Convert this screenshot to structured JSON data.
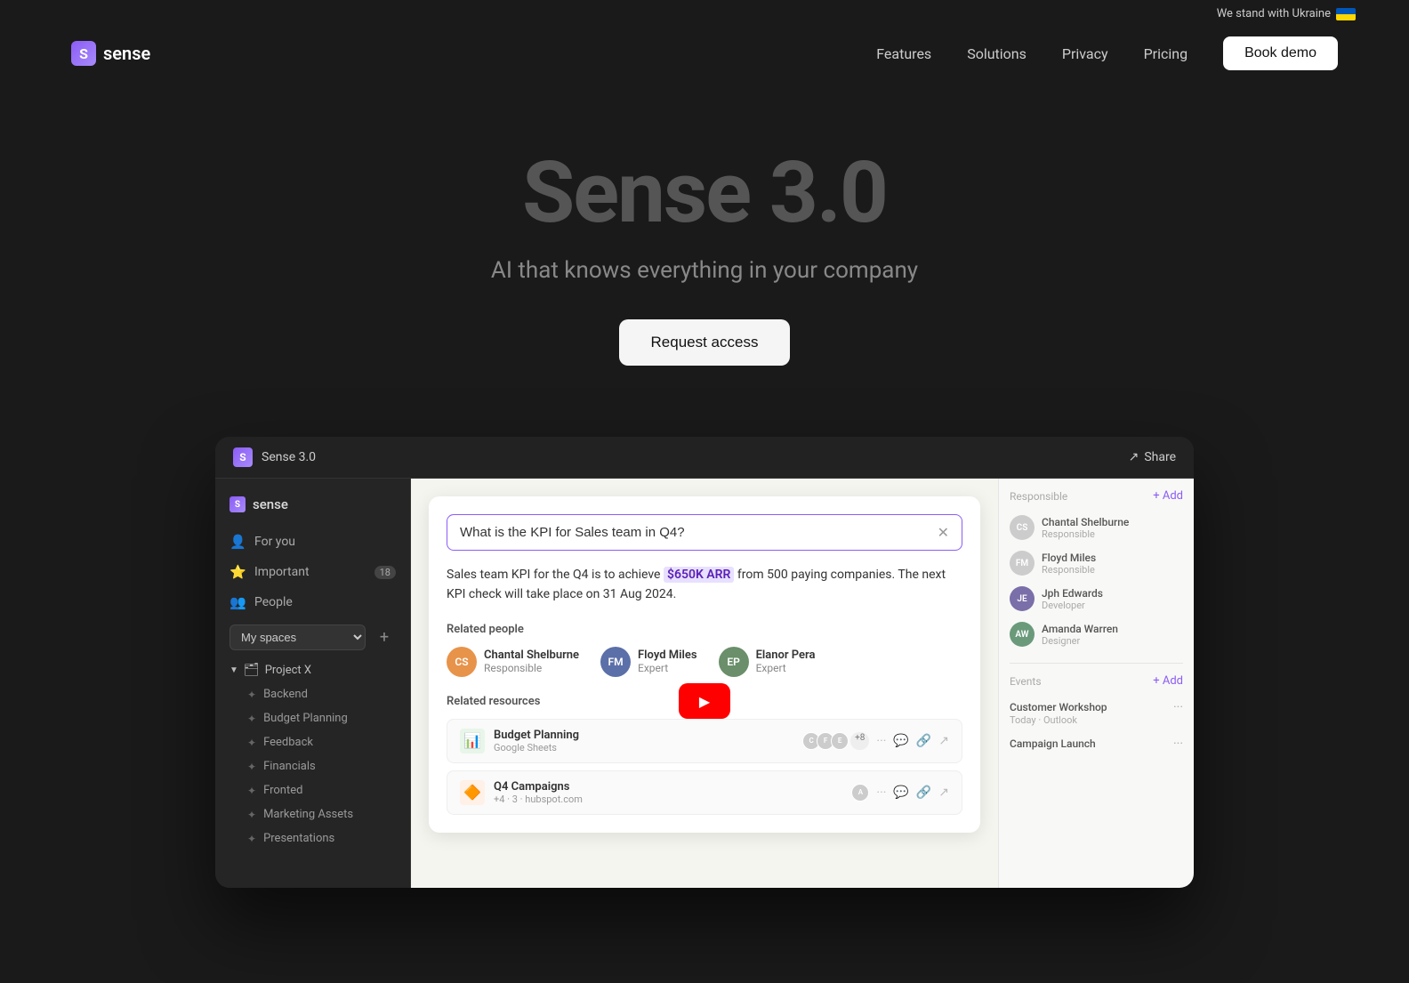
{
  "topBanner": {
    "ukraineText": "We stand with Ukraine"
  },
  "nav": {
    "logoText": "sense",
    "links": [
      {
        "label": "Features",
        "id": "features"
      },
      {
        "label": "Solutions",
        "id": "solutions"
      },
      {
        "label": "Privacy",
        "id": "privacy"
      },
      {
        "label": "Pricing",
        "id": "pricing"
      }
    ],
    "bookDemoLabel": "Book demo"
  },
  "hero": {
    "title": "Sense 3.0",
    "subtitle": "AI that knows everything in your company",
    "ctaLabel": "Request access"
  },
  "appPreview": {
    "titlebarTitle": "Sense 3.0",
    "shareLabel": "Share"
  },
  "sidebar": {
    "logoText": "sense",
    "navItems": [
      {
        "label": "For you",
        "icon": "👤"
      },
      {
        "label": "Important",
        "icon": "⭐",
        "badge": "18"
      },
      {
        "label": "People",
        "icon": "👥"
      }
    ],
    "spacesLabel": "My spaces",
    "projectName": "Project X",
    "subitems": [
      "Backend",
      "Budget Planning",
      "Feedback",
      "Financials",
      "Fronted",
      "Marketing Assets",
      "Presentations"
    ]
  },
  "aiPanel": {
    "searchQuery": "What is the KPI for Sales team in Q4?",
    "answerText": "Sales team KPI for the Q4 is to achieve",
    "highlight": "$650K ARR",
    "answerText2": "from 500 paying companies. The next KPI check will take place on 31 Aug 2024.",
    "relatedPeopleTitle": "Related people",
    "people": [
      {
        "name": "Chantal Shelburne",
        "role": "Responsible",
        "initials": "CS"
      },
      {
        "name": "Floyd Miles",
        "role": "Expert",
        "initials": "FM"
      },
      {
        "name": "Elanor Pera",
        "role": "Expert",
        "initials": "EP"
      }
    ],
    "relatedResourcesTitle": "Related resources",
    "resources": [
      {
        "name": "Budget Planning",
        "source": "Google Sheets",
        "type": "sheets",
        "count": "+8"
      },
      {
        "name": "Q4 Campaigns",
        "source": "+4  · 3 · hubspot.com",
        "type": "hubspot"
      }
    ]
  },
  "rightPanel": {
    "responsibleLabel": "Responsible",
    "addLabel": "+ Add",
    "people": [
      {
        "name": "Chantal Shelburne",
        "role": "Responsible",
        "initials": "CS"
      },
      {
        "name": "Floyd Miles",
        "role": "Responsible",
        "initials": "FM"
      },
      {
        "name": "Jph Edwards",
        "role": "Developer",
        "initials": "JE"
      },
      {
        "name": "Amanda Warren",
        "role": "Designer",
        "initials": "AW"
      }
    ],
    "eventsLabel": "Events",
    "addEventsLabel": "+ Add",
    "events": [
      {
        "title": "Customer Workshop",
        "sub": "Today · Outlook"
      },
      {
        "title": "Campaign Launch",
        "sub": ""
      }
    ]
  }
}
